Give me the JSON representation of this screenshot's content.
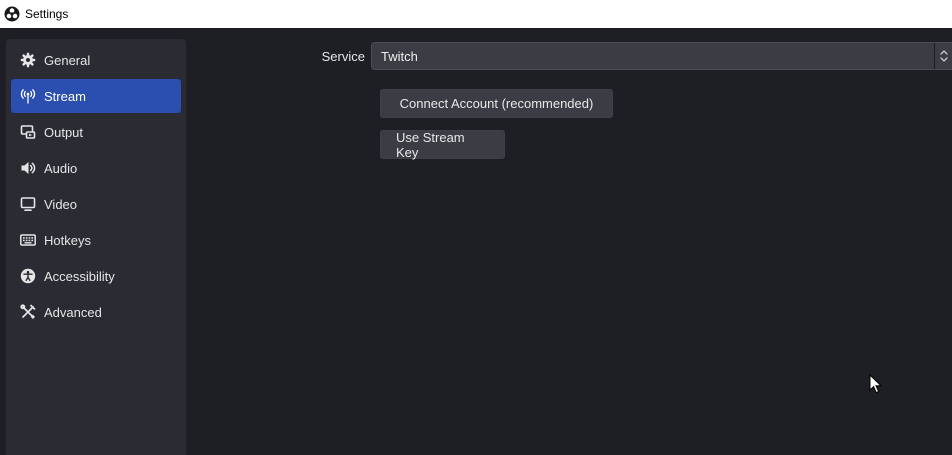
{
  "window": {
    "title": "Settings",
    "app_icon": "obs-logo-icon"
  },
  "sidebar": {
    "items": [
      {
        "label": "General",
        "icon": "gear-icon",
        "active": false
      },
      {
        "label": "Stream",
        "icon": "antenna-icon",
        "active": true
      },
      {
        "label": "Output",
        "icon": "output-icon",
        "active": false
      },
      {
        "label": "Audio",
        "icon": "speaker-icon",
        "active": false
      },
      {
        "label": "Video",
        "icon": "monitor-icon",
        "active": false
      },
      {
        "label": "Hotkeys",
        "icon": "keyboard-icon",
        "active": false
      },
      {
        "label": "Accessibility",
        "icon": "accessibility-icon",
        "active": false
      },
      {
        "label": "Advanced",
        "icon": "tools-icon",
        "active": false
      }
    ]
  },
  "stream": {
    "service_label": "Service",
    "service_value": "Twitch",
    "connect_button": "Connect Account (recommended)",
    "stream_key_button": "Use Stream Key"
  },
  "colors": {
    "background": "#1e1f25",
    "sidebar": "#2a2b33",
    "accent": "#2a4fb0",
    "control": "#3b3c44",
    "text": "#e6e6e6"
  }
}
